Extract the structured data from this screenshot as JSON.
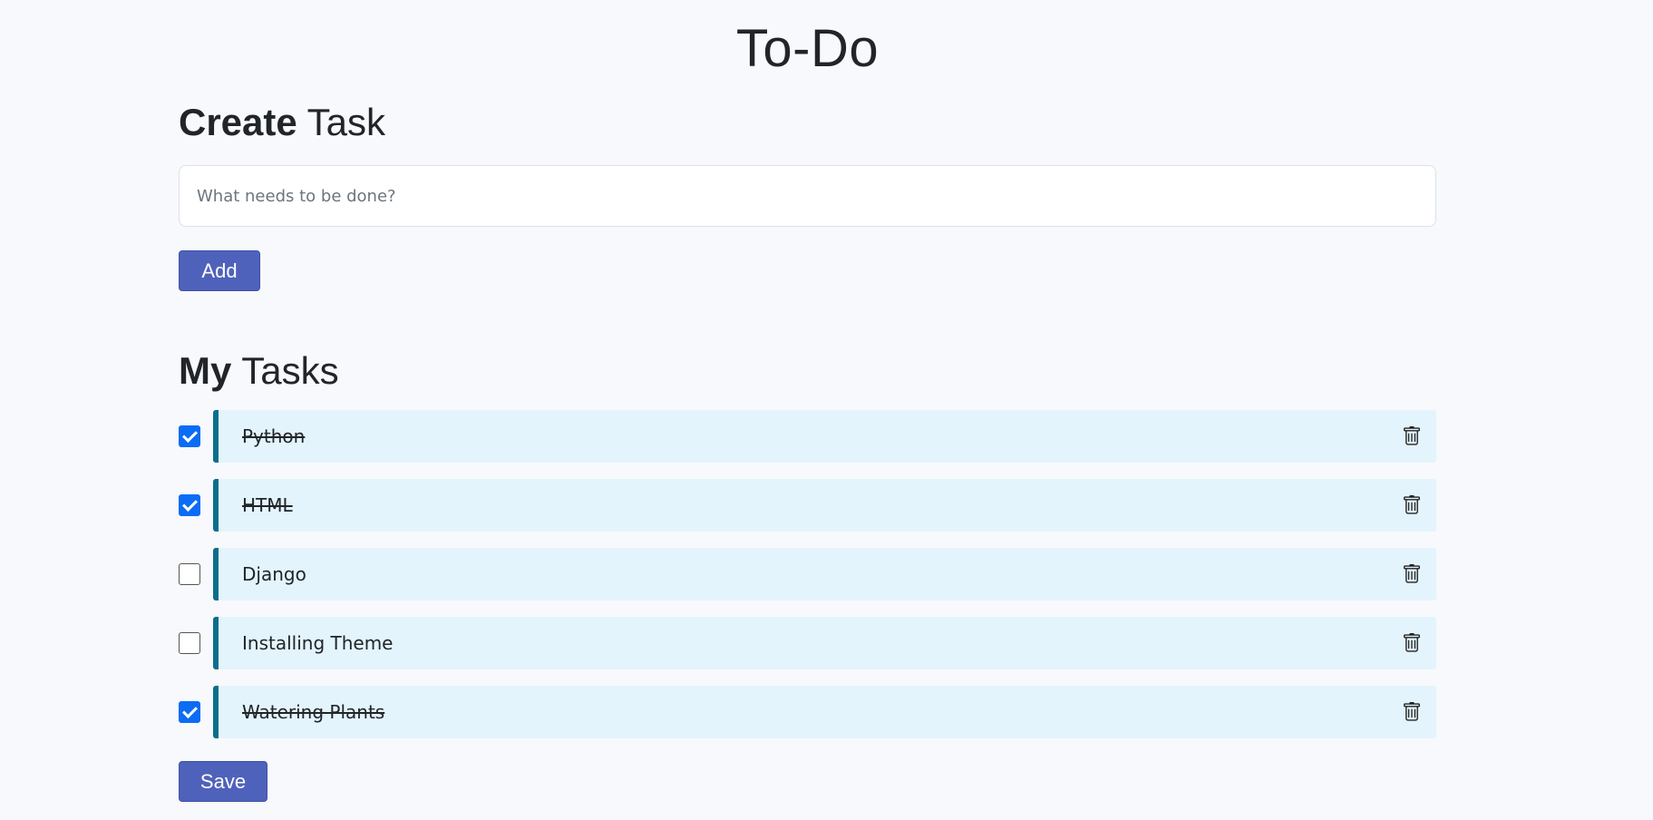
{
  "header": {
    "title": "To-Do"
  },
  "create_section": {
    "title_bold": "Create",
    "title_rest": " Task",
    "input": {
      "placeholder": "What needs to be done?",
      "value": ""
    },
    "add_label": "Add"
  },
  "tasks_section": {
    "title_bold": "My",
    "title_rest": " Tasks",
    "tasks": [
      {
        "label": "Python",
        "done": true
      },
      {
        "label": "HTML",
        "done": true
      },
      {
        "label": "Django",
        "done": false
      },
      {
        "label": "Installing Theme",
        "done": false
      },
      {
        "label": "Watering Plants",
        "done": true
      }
    ],
    "delete_icon": "trash-icon",
    "save_label": "Save"
  },
  "colors": {
    "background": "#f8f9fd",
    "button": "#4f62bb",
    "task_card": "#e3f4fc",
    "task_accent": "#0b6e8c",
    "checkbox_checked": "#0b6cf5"
  }
}
